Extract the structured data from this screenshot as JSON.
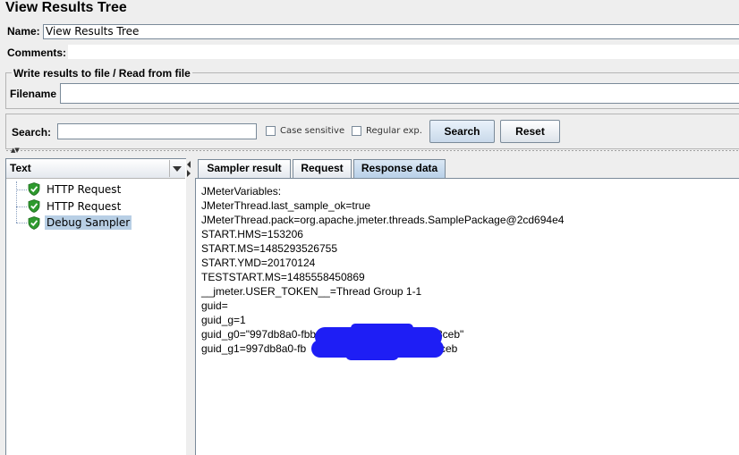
{
  "window": {
    "title": "View Results Tree"
  },
  "form": {
    "name_label": "Name:",
    "name_value": "View Results Tree",
    "comments_label": "Comments:",
    "file_section_title": "Write results to file / Read from file",
    "filename_label": "Filename"
  },
  "search": {
    "label": "Search:",
    "case_sensitive_label": "Case sensitive",
    "regex_label": "Regular exp.",
    "search_button": "Search",
    "reset_button": "Reset"
  },
  "renderer": {
    "selected": "Text"
  },
  "tree": {
    "items": [
      {
        "label": "HTTP Request",
        "status": "success"
      },
      {
        "label": "HTTP Request",
        "status": "success"
      },
      {
        "label": "Debug Sampler",
        "status": "success",
        "selected": true
      }
    ]
  },
  "tabs": [
    {
      "label": "Sampler result"
    },
    {
      "label": "Request"
    },
    {
      "label": "Response data",
      "active": true
    }
  ],
  "response_lines": [
    "JMeterVariables:",
    "JMeterThread.last_sample_ok=true",
    "JMeterThread.pack=org.apache.jmeter.threads.SamplePackage@2cd694e4",
    "START.HMS=153206",
    "START.MS=1485293526755",
    "START.YMD=20170124",
    "TESTSTART.MS=1485558450869",
    "__jmeter.USER_TOKEN__=Thread Group 1-1",
    "guid=",
    "guid_g=1",
    "guid_g0=\"997db8a0-fbb",
    "guid_g1=997db8a0-fb"
  ],
  "redacted_tails": {
    "guid_g0": "8ceb\"",
    "guid_g1": "ceb"
  },
  "colors": {
    "selection": "#b8cfe5",
    "active_tab": "#b8d0e8",
    "redaction": "#1e1ef5",
    "success_icon": "#2e9a2e"
  }
}
